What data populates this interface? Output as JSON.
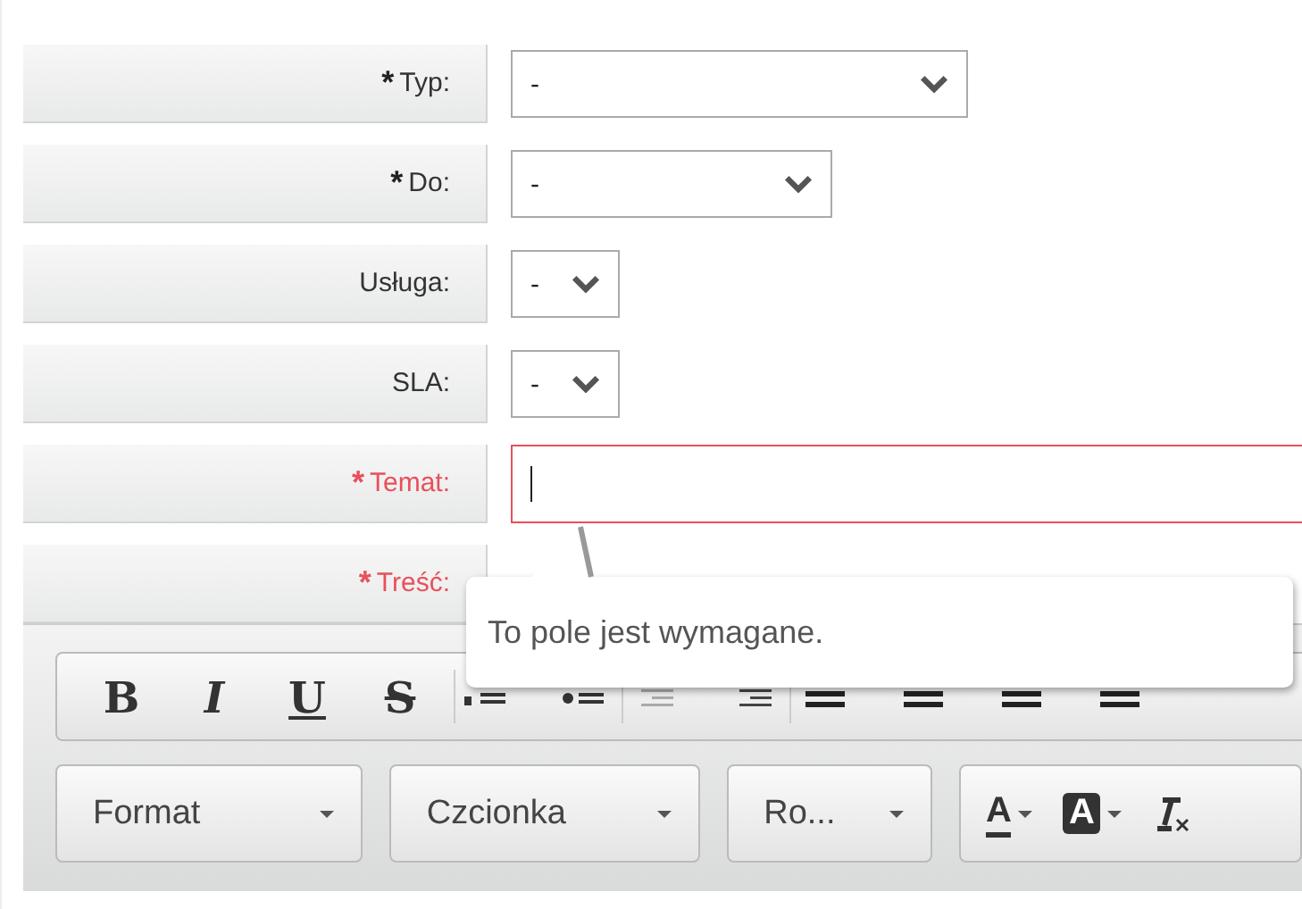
{
  "fields": [
    {
      "label": "Typ:",
      "required": true,
      "invalid": false,
      "kind": "select",
      "value": "-"
    },
    {
      "label": "Do:",
      "required": true,
      "invalid": false,
      "kind": "select",
      "value": "-"
    },
    {
      "label": "Usługa:",
      "required": false,
      "invalid": false,
      "kind": "select",
      "value": "-"
    },
    {
      "label": "SLA:",
      "required": false,
      "invalid": false,
      "kind": "select",
      "value": "-"
    },
    {
      "label": "Temat:",
      "required": true,
      "invalid": true,
      "kind": "text",
      "focused": true
    },
    {
      "label": "Treść:",
      "required": true,
      "invalid": true,
      "kind": "editor"
    }
  ],
  "required_mark": "*",
  "tooltip": {
    "text": "To pole jest wymagane."
  },
  "editor": {
    "style_buttons": [
      "B",
      "I",
      "U",
      "S"
    ],
    "dropdowns": [
      "Format",
      "Czcionka",
      "Ro..."
    ],
    "color_buttons": [
      {
        "label": "A",
        "kind": "text"
      },
      {
        "label": "A",
        "kind": "background"
      }
    ]
  }
}
